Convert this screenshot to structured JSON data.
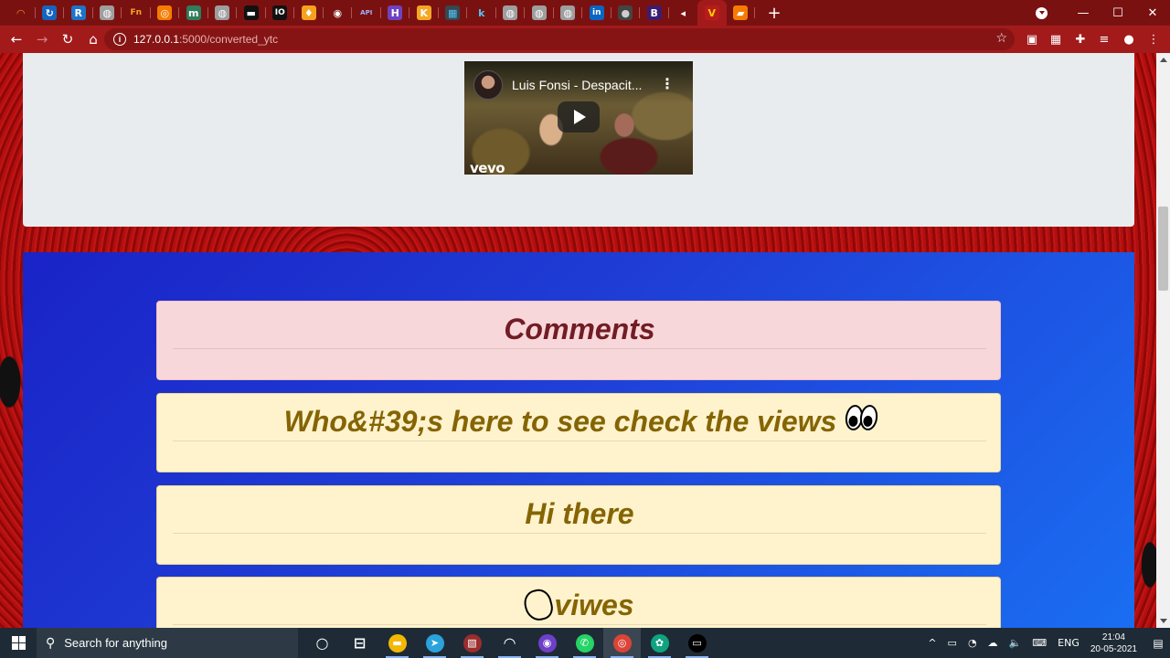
{
  "browser": {
    "tabs": [
      {
        "name": "tab-1",
        "glyph": "◠",
        "bg": "#7a1111",
        "fg": "#f28a1e"
      },
      {
        "name": "tab-2",
        "glyph": "↻",
        "bg": "#1565c0",
        "fg": "#ffffff"
      },
      {
        "name": "tab-3",
        "glyph": "R",
        "bg": "#1e73c8",
        "fg": "#ffffff"
      },
      {
        "name": "tab-4",
        "glyph": "◍",
        "bg": "#9e9e9e",
        "fg": "#ffffff"
      },
      {
        "name": "tab-5",
        "glyph": "Fn",
        "bg": "#7a1111",
        "fg": "#f5a623"
      },
      {
        "name": "tab-6",
        "glyph": "◎",
        "bg": "#f57c00",
        "fg": "#ffffff"
      },
      {
        "name": "tab-7",
        "glyph": "m",
        "bg": "#2e7d5b",
        "fg": "#ffffff"
      },
      {
        "name": "tab-8",
        "glyph": "◍",
        "bg": "#9e9e9e",
        "fg": "#ffffff"
      },
      {
        "name": "tab-9",
        "glyph": "▬",
        "bg": "#111111",
        "fg": "#ffffff"
      },
      {
        "name": "tab-10",
        "glyph": "IO",
        "bg": "#111111",
        "fg": "#ffffff"
      },
      {
        "name": "tab-11",
        "glyph": "♦",
        "bg": "#f6a21e",
        "fg": "#ffffff"
      },
      {
        "name": "tab-12",
        "glyph": "◉",
        "bg": "#7a1111",
        "fg": "#ffffff"
      },
      {
        "name": "tab-13",
        "glyph": "API",
        "bg": "#7a1111",
        "fg": "#9fb3ff"
      },
      {
        "name": "tab-14",
        "glyph": "H",
        "bg": "#6f42c1",
        "fg": "#ffffff"
      },
      {
        "name": "tab-15",
        "glyph": "K",
        "bg": "#f5a623",
        "fg": "#ffffff"
      },
      {
        "name": "tab-16",
        "glyph": "▦",
        "bg": "#37474f",
        "fg": "#4fc3f7"
      },
      {
        "name": "tab-17",
        "glyph": "k",
        "bg": "#7a1111",
        "fg": "#4fc3f7"
      },
      {
        "name": "tab-18",
        "glyph": "◍",
        "bg": "#9e9e9e",
        "fg": "#ffffff"
      },
      {
        "name": "tab-19",
        "glyph": "◍",
        "bg": "#9e9e9e",
        "fg": "#ffffff"
      },
      {
        "name": "tab-20",
        "glyph": "◍",
        "bg": "#9e9e9e",
        "fg": "#ffffff"
      },
      {
        "name": "tab-21",
        "glyph": "in",
        "bg": "#0a66c2",
        "fg": "#ffffff"
      },
      {
        "name": "tab-22",
        "glyph": "●",
        "bg": "#444444",
        "fg": "#cccccc"
      },
      {
        "name": "tab-23",
        "glyph": "B",
        "bg": "#3d1c6e",
        "fg": "#ffffff"
      },
      {
        "name": "tab-24",
        "glyph": "◂",
        "bg": "#7a1111",
        "fg": "#ffffff"
      },
      {
        "name": "tab-25",
        "glyph": "V",
        "bg": "#b71c1c",
        "fg": "#ffcc00"
      },
      {
        "name": "tab-26",
        "glyph": "▰",
        "bg": "#f57c00",
        "fg": "#ffffff"
      }
    ],
    "active_tab_index": 24,
    "new_tab": "+",
    "window": {
      "minimize": "—",
      "maximize": "☐",
      "close": "✕"
    },
    "nav": {
      "back": "←",
      "forward": "→",
      "reload": "↻",
      "home": "⌂"
    },
    "url_host": "127.0.0.1",
    "url_path": ":5000/converted_ytc",
    "star": "☆",
    "extensions": [
      {
        "name": "extension-icon-1",
        "glyph": "▣"
      },
      {
        "name": "extension-icon-2",
        "glyph": "▦"
      },
      {
        "name": "extension-puzzle-icon",
        "glyph": "✚"
      },
      {
        "name": "reading-list-icon",
        "glyph": "≡"
      },
      {
        "name": "profile-avatar-icon",
        "glyph": "●"
      },
      {
        "name": "browser-menu-icon",
        "glyph": "⋮"
      }
    ],
    "colors": {
      "frame": "#7a1111",
      "toolbar": "#a31a1a"
    }
  },
  "video": {
    "title": "Luis Fonsi - Despacit...",
    "menu": "⋮",
    "watermark": "vevo"
  },
  "comments": {
    "heading": "Comments",
    "items": [
      {
        "text": "Who&#39;s here to see check the views",
        "emoji": "eyes"
      },
      {
        "text": "Hi there",
        "emoji": ""
      },
      {
        "text": "viwes",
        "emoji": "hand"
      }
    ]
  },
  "taskbar": {
    "search_placeholder": "Search for anything",
    "apps": [
      {
        "name": "cortana-icon",
        "glyph": "○",
        "bg": "transparent"
      },
      {
        "name": "task-view-icon",
        "glyph": "⊟",
        "bg": "transparent"
      },
      {
        "name": "file-explorer-icon",
        "glyph": "▬",
        "bg": "#f2b800"
      },
      {
        "name": "telegram-icon",
        "glyph": "➤",
        "bg": "#2aa3dd"
      },
      {
        "name": "photo-app-icon",
        "glyph": "▧",
        "bg": "#9b2d2d"
      },
      {
        "name": "jupyter-icon",
        "glyph": "◠",
        "bg": "transparent"
      },
      {
        "name": "github-desktop-icon",
        "glyph": "◉",
        "bg": "#6e40c9"
      },
      {
        "name": "whatsapp-icon",
        "glyph": "✆",
        "bg": "#25d366"
      },
      {
        "name": "chrome-icon",
        "glyph": "◎",
        "bg": "#db4437"
      },
      {
        "name": "chatgpt-icon",
        "glyph": "✿",
        "bg": "#10a37f"
      },
      {
        "name": "terminal-icon",
        "glyph": "▭",
        "bg": "#000000"
      }
    ],
    "tray": {
      "chevron": "^",
      "icons": [
        "▭",
        "◔",
        "☁",
        "🔈",
        "⌨"
      ],
      "language": "ENG",
      "time": "21:04",
      "date": "20-05-2021",
      "notifications": "▤"
    }
  }
}
